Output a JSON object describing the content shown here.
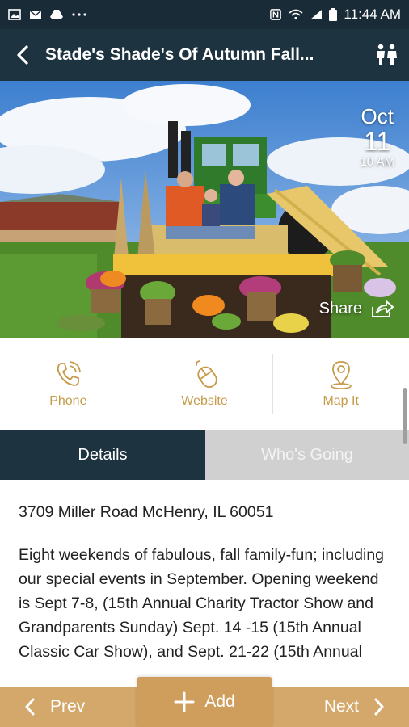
{
  "status_bar": {
    "time": "11:44 AM",
    "left_icons": [
      "image-icon",
      "mail-icon",
      "drive-icon",
      "more-icon"
    ],
    "right_icons": [
      "nfc-icon",
      "wifi-icon",
      "signal-icon",
      "battery-icon"
    ]
  },
  "app_bar": {
    "back_icon": "chevron-left-icon",
    "title": "Stade's Shade's Of Autumn Fall...",
    "people_icon": "people-icon"
  },
  "event": {
    "month": "Oct",
    "day": "11",
    "time": "10 AM",
    "share_label": "Share"
  },
  "actions": [
    {
      "label": "Phone",
      "icon": "phone-icon"
    },
    {
      "label": "Website",
      "icon": "mouse-icon"
    },
    {
      "label": "Map It",
      "icon": "map-pin-icon"
    }
  ],
  "tabs": [
    {
      "label": "Details",
      "active": true
    },
    {
      "label": "Who's Going",
      "active": false
    }
  ],
  "details": {
    "address": "3709 Miller Road McHenry, IL 60051",
    "description": "Eight weekends of fabulous, fall family-fun; including our special events in September. Opening weekend is Sept 7-8, (15th Annual Charity Tractor Show and Grandparents Sunday) Sept. 14 -15 (15th Annual Classic Car Show), and Sept. 21-22 (15th Annual"
  },
  "bottom_bar": {
    "prev_label": "Prev",
    "add_label": "Add",
    "next_label": "Next"
  },
  "colors": {
    "navy": "#1e3340",
    "gold": "#c69a4a",
    "bottom_bar": "#d4a86a"
  }
}
